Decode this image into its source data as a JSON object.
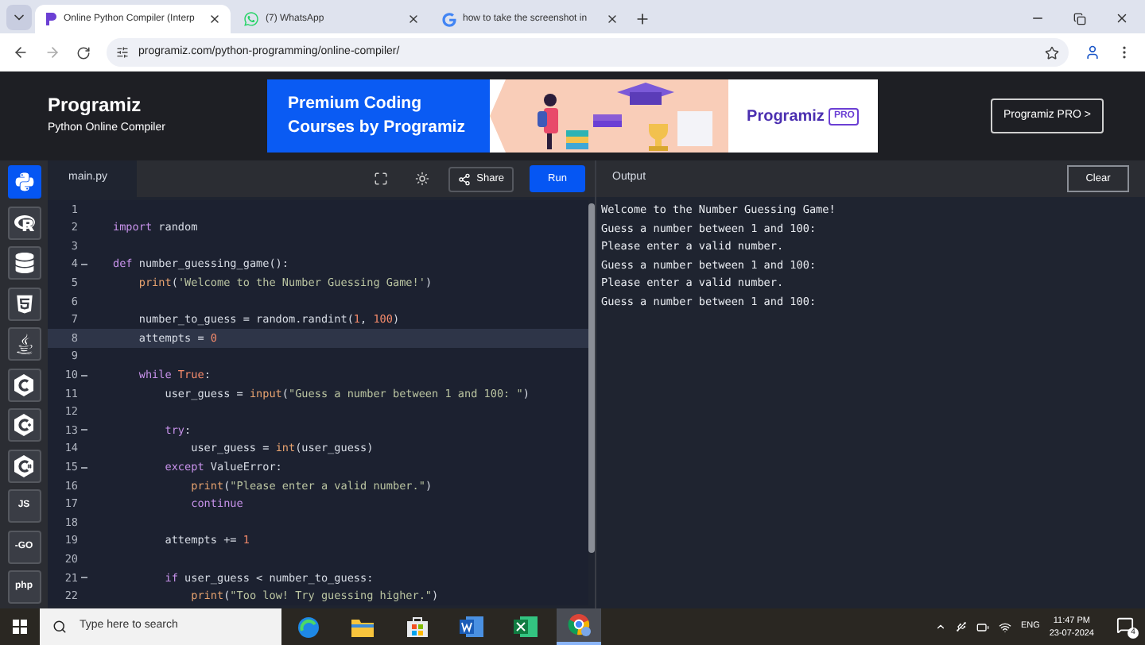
{
  "browser": {
    "tabs": [
      {
        "kind": "programiz",
        "title": "Online Python Compiler (Interp",
        "selected": true
      },
      {
        "kind": "whatsapp",
        "title": "(7) WhatsApp",
        "selected": false
      },
      {
        "kind": "google",
        "title": "how to take the screenshot in",
        "selected": false
      }
    ],
    "url": "programiz.com/python-programming/online-compiler/"
  },
  "header": {
    "logo": "Programiz",
    "subtitle": "Python Online Compiler",
    "banner": {
      "line1": "Premium Coding",
      "line2": "Courses by Programiz",
      "brand": "Programiz",
      "badge": "PRO"
    },
    "pro_button": "Programiz PRO >"
  },
  "languages": [
    {
      "kind": "python",
      "selected": true
    },
    {
      "kind": "r",
      "selected": false
    },
    {
      "kind": "sql",
      "selected": false
    },
    {
      "kind": "html",
      "selected": false
    },
    {
      "kind": "java",
      "selected": false
    },
    {
      "kind": "c",
      "selected": false
    },
    {
      "kind": "cpp",
      "selected": false
    },
    {
      "kind": "csharp",
      "selected": false
    },
    {
      "kind": "text",
      "label": "JS",
      "selected": false
    },
    {
      "kind": "text",
      "label": "-GO",
      "selected": false
    },
    {
      "kind": "text",
      "label": "php",
      "selected": false
    }
  ],
  "editor": {
    "filename": "main.py",
    "share": "Share",
    "run": "Run",
    "lines": [
      {
        "number": "1",
        "fold": false,
        "current": false
      },
      {
        "number": "2",
        "fold": false,
        "current": false,
        "tokens": [
          {
            "text": "import",
            "kind": "kw"
          },
          {
            "text": " random",
            "kind": "plain"
          }
        ]
      },
      {
        "number": "3",
        "fold": false,
        "current": false
      },
      {
        "number": "4",
        "fold": true,
        "current": false,
        "tokens": [
          {
            "text": "def",
            "kind": "kw"
          },
          {
            "text": " number_guessing_game():",
            "kind": "plain"
          }
        ]
      },
      {
        "number": "5",
        "fold": false,
        "current": false,
        "tokens": [
          {
            "text": "    print",
            "kind": "fn"
          },
          {
            "text": "(",
            "kind": "plain"
          },
          {
            "text": "'Welcome to the Number Guessing Game!'",
            "kind": "str"
          },
          {
            "text": ")",
            "kind": "plain"
          }
        ]
      },
      {
        "number": "6",
        "fold": false,
        "current": false
      },
      {
        "number": "7",
        "fold": false,
        "current": false,
        "tokens": [
          {
            "text": "    number_to_guess = random.randint(",
            "kind": "plain"
          },
          {
            "text": "1",
            "kind": "num"
          },
          {
            "text": ", ",
            "kind": "plain"
          },
          {
            "text": "100",
            "kind": "num"
          },
          {
            "text": ")",
            "kind": "plain"
          }
        ]
      },
      {
        "number": "8",
        "fold": false,
        "current": true,
        "tokens": [
          {
            "text": "    attempts = ",
            "kind": "plain"
          },
          {
            "text": "0",
            "kind": "num"
          }
        ]
      },
      {
        "number": "9",
        "fold": false,
        "current": false
      },
      {
        "number": "10",
        "fold": true,
        "current": false,
        "tokens": [
          {
            "text": "    while",
            "kind": "kw"
          },
          {
            "text": " True",
            "kind": "num"
          },
          {
            "text": ":",
            "kind": "plain"
          }
        ]
      },
      {
        "number": "11",
        "fold": false,
        "current": false,
        "tokens": [
          {
            "text": "        user_guess = ",
            "kind": "plain"
          },
          {
            "text": "input",
            "kind": "fn"
          },
          {
            "text": "(",
            "kind": "plain"
          },
          {
            "text": "\"Guess a number between 1 and 100: \"",
            "kind": "str"
          },
          {
            "text": ")",
            "kind": "plain"
          }
        ]
      },
      {
        "number": "12",
        "fold": false,
        "current": false
      },
      {
        "number": "13",
        "fold": true,
        "current": false,
        "tokens": [
          {
            "text": "        try",
            "kind": "kw"
          },
          {
            "text": ":",
            "kind": "plain"
          }
        ]
      },
      {
        "number": "14",
        "fold": false,
        "current": false,
        "tokens": [
          {
            "text": "            user_guess = ",
            "kind": "plain"
          },
          {
            "text": "int",
            "kind": "fn"
          },
          {
            "text": "(user_guess)",
            "kind": "plain"
          }
        ]
      },
      {
        "number": "15",
        "fold": true,
        "current": false,
        "tokens": [
          {
            "text": "        except",
            "kind": "kw"
          },
          {
            "text": " ValueError:",
            "kind": "plain"
          }
        ]
      },
      {
        "number": "16",
        "fold": false,
        "current": false,
        "tokens": [
          {
            "text": "            print",
            "kind": "fn"
          },
          {
            "text": "(",
            "kind": "plain"
          },
          {
            "text": "\"Please enter a valid number.\"",
            "kind": "str"
          },
          {
            "text": ")",
            "kind": "plain"
          }
        ]
      },
      {
        "number": "17",
        "fold": false,
        "current": false,
        "tokens": [
          {
            "text": "            continue",
            "kind": "kw"
          }
        ]
      },
      {
        "number": "18",
        "fold": false,
        "current": false
      },
      {
        "number": "19",
        "fold": false,
        "current": false,
        "tokens": [
          {
            "text": "        attempts += ",
            "kind": "plain"
          },
          {
            "text": "1",
            "kind": "num"
          }
        ]
      },
      {
        "number": "20",
        "fold": false,
        "current": false
      },
      {
        "number": "21",
        "fold": true,
        "current": false,
        "tokens": [
          {
            "text": "        if",
            "kind": "kw"
          },
          {
            "text": " user_guess < number_to_guess:",
            "kind": "plain"
          }
        ]
      },
      {
        "number": "22",
        "fold": false,
        "current": false,
        "tokens": [
          {
            "text": "            print",
            "kind": "fn"
          },
          {
            "text": "(",
            "kind": "plain"
          },
          {
            "text": "\"Too low! Try guessing higher.\"",
            "kind": "str"
          },
          {
            "text": ")",
            "kind": "plain"
          }
        ]
      }
    ]
  },
  "output": {
    "title": "Output",
    "clear": "Clear",
    "lines": [
      "Welcome to the Number Guessing Game!",
      "Guess a number between 1 and 100:",
      "Please enter a valid number.",
      "Guess a number between 1 and 100:",
      "Please enter a valid number.",
      "Guess a number between 1 and 100:"
    ]
  },
  "taskbar": {
    "search_placeholder": "Type here to search",
    "apps": [
      {
        "kind": "edge",
        "selected": false
      },
      {
        "kind": "explorer",
        "selected": false
      },
      {
        "kind": "store",
        "selected": false
      },
      {
        "kind": "word",
        "selected": false
      },
      {
        "kind": "excel",
        "selected": false
      },
      {
        "kind": "chrome",
        "selected": true
      }
    ],
    "language": "ENG",
    "time": "11:47 PM",
    "date": "23-07-2024",
    "notifications": "4"
  }
}
